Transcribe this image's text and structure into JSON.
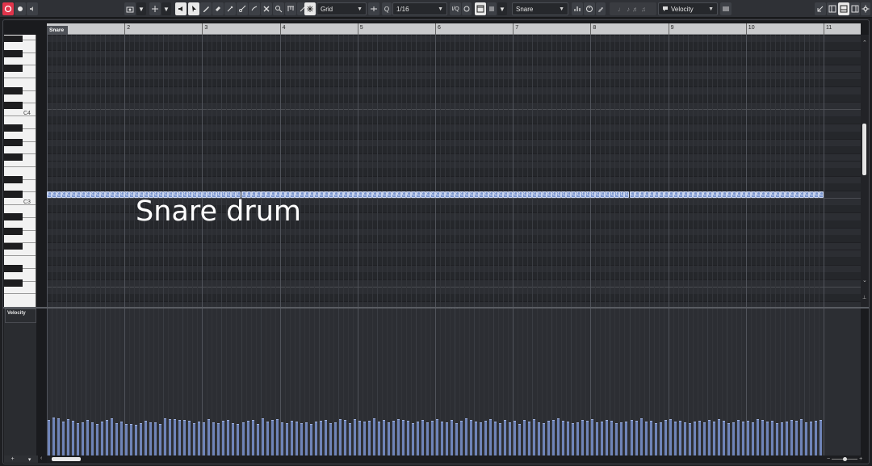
{
  "toolbar": {
    "snap_type": "Grid",
    "quantize": "1/16",
    "quantize_icon": "Q",
    "part_select": "Snare",
    "controller_select": "Velocity",
    "iq_label": "I/Q"
  },
  "ruler": {
    "bars": [
      "2",
      "3",
      "4",
      "5",
      "6",
      "7",
      "8",
      "9",
      "10",
      "11"
    ]
  },
  "part": {
    "name": "Snare"
  },
  "keyboard": {
    "labels": [
      "C4",
      "C3"
    ]
  },
  "annotation": "Snare drum",
  "notes": {
    "pitch": "C3",
    "label": "C",
    "count": 160
  },
  "controller_lane": {
    "name": "Velocity",
    "velocities": [
      88,
      95,
      93,
      84,
      90,
      86,
      80,
      83,
      88,
      82,
      78,
      84,
      88,
      92,
      80,
      85,
      79,
      78,
      77,
      80,
      86,
      83,
      82,
      79,
      92,
      90,
      91,
      88,
      89,
      86,
      80,
      84,
      82,
      90,
      82,
      80,
      86,
      88,
      80,
      78,
      82,
      86,
      88,
      78,
      92,
      84,
      88,
      90,
      82,
      80,
      86,
      84,
      80,
      82,
      78,
      84,
      86,
      88,
      80,
      82,
      90,
      88,
      80,
      90,
      87,
      84,
      86,
      92,
      84,
      88,
      82,
      86,
      90,
      88,
      86,
      80,
      84,
      88,
      82,
      86,
      90,
      84,
      82,
      88,
      80,
      86,
      92,
      88,
      84,
      82,
      86,
      90,
      84,
      80,
      88,
      82,
      86,
      78,
      88,
      84,
      90,
      82,
      80,
      86,
      88,
      92,
      86,
      84,
      80,
      82,
      88,
      86,
      90,
      82,
      84,
      88,
      86,
      80,
      82,
      84,
      88,
      86,
      92,
      84,
      86,
      80,
      82,
      88,
      90,
      84,
      86,
      82,
      80,
      84,
      86,
      82,
      88,
      84,
      90,
      86,
      80,
      82,
      88,
      84,
      86,
      82,
      90,
      88,
      84,
      86,
      80,
      82,
      84,
      88,
      86,
      90,
      82,
      84,
      86,
      88
    ],
    "max_velocity": 127
  },
  "colors": {
    "accent_red": "#e0344b",
    "note_fill": "#7b96cf",
    "velocity_bar": "#6f84b8",
    "grid_bg": "#2c2e33"
  }
}
